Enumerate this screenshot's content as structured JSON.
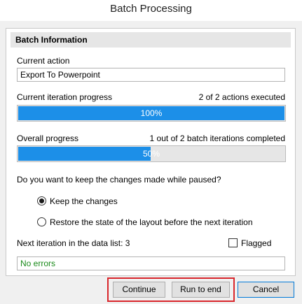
{
  "window": {
    "title": "Batch Processing"
  },
  "group": {
    "header": "Batch Information"
  },
  "current_action": {
    "label": "Current action",
    "value": "Export To Powerpoint"
  },
  "iteration_progress": {
    "label": "Current iteration progress",
    "status": "2 of 2 actions executed",
    "percent_text": "100%",
    "fraction": 1.0
  },
  "overall_progress": {
    "label": "Overall progress",
    "status": "1 out of 2 batch iterations completed",
    "percent_text": "50%",
    "fraction": 0.5
  },
  "question": "Do you want to keep the changes made while paused?",
  "options": [
    {
      "label": "Keep the changes",
      "selected": true
    },
    {
      "label": "Restore the state of the layout before the next iteration",
      "selected": false
    }
  ],
  "next_iteration": {
    "label": "Next iteration in the data list: 3"
  },
  "flagged": {
    "label": "Flagged",
    "checked": false
  },
  "errors": {
    "value": "No errors"
  },
  "buttons": {
    "continue": "Continue",
    "run_to_end": "Run to end",
    "cancel": "Cancel"
  },
  "colors": {
    "progress_fill": "#1c8fe8",
    "highlight": "#d9262c",
    "ok_text": "#1a8a1a"
  }
}
